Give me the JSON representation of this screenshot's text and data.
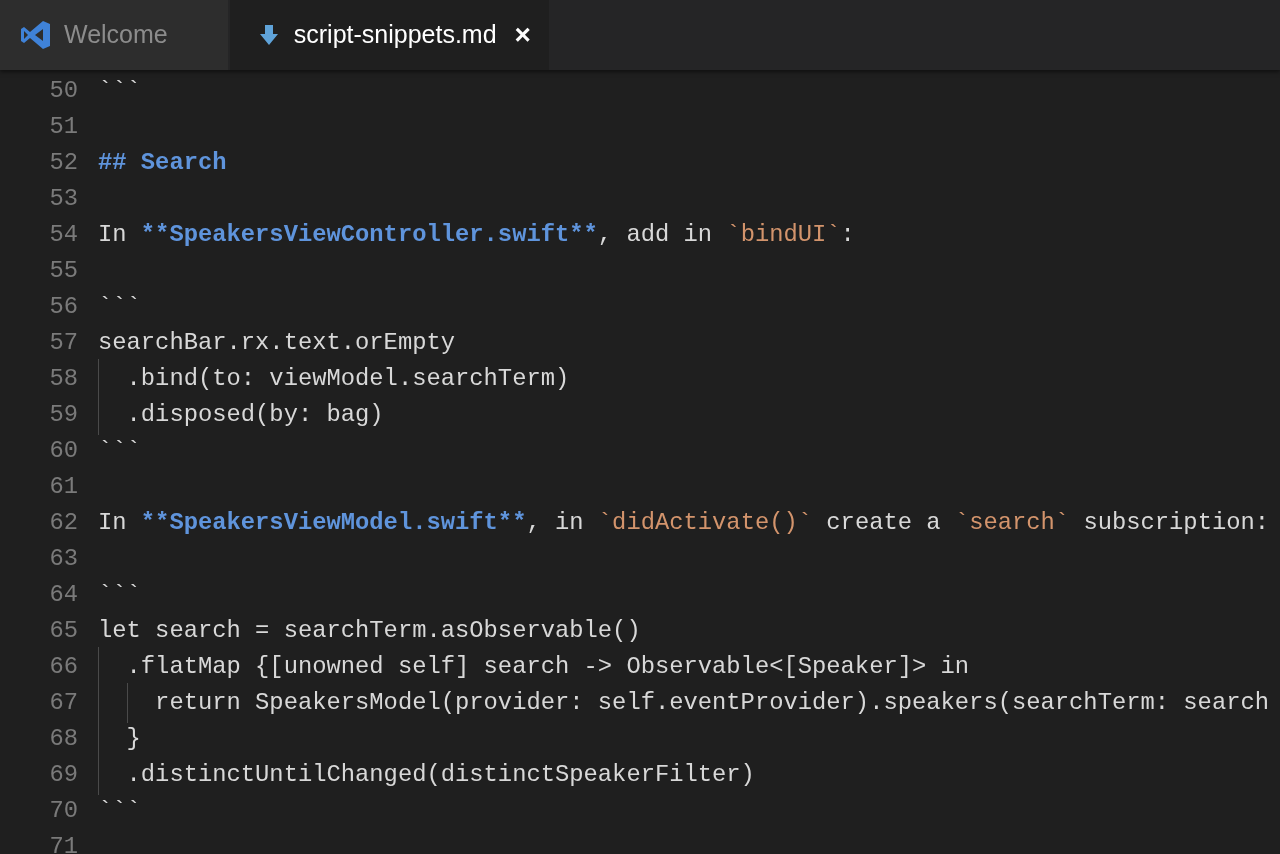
{
  "tabs": [
    {
      "label": "Welcome",
      "selected": false
    },
    {
      "label": "script-snippets.md",
      "selected": true,
      "close": "×"
    }
  ],
  "editor": {
    "lines": [
      {
        "number": "50",
        "tokens": [
          {
            "kind": "text",
            "text": "```"
          }
        ]
      },
      {
        "number": "51"
      },
      {
        "number": "52",
        "tokens": [
          {
            "kind": "heading",
            "text": "## Search"
          }
        ]
      },
      {
        "number": "53"
      },
      {
        "number": "54",
        "tokens": [
          {
            "kind": "text",
            "text": "In "
          },
          {
            "kind": "bold",
            "text": "**SpeakersViewController.swift**"
          },
          {
            "kind": "text",
            "text": ", add in "
          },
          {
            "kind": "code",
            "text": "`bindUI`"
          },
          {
            "kind": "text",
            "text": ":"
          }
        ]
      },
      {
        "number": "55"
      },
      {
        "number": "56",
        "tokens": [
          {
            "kind": "text",
            "text": "```"
          }
        ]
      },
      {
        "number": "57",
        "tokens": [
          {
            "kind": "text",
            "text": "searchBar.rx.text.orEmpty"
          }
        ]
      },
      {
        "number": "58",
        "tokens": [
          {
            "kind": "text",
            "text": "  .bind(to: viewModel.searchTerm)"
          }
        ]
      },
      {
        "number": "59",
        "tokens": [
          {
            "kind": "text",
            "text": "  .disposed(by: bag)"
          }
        ]
      },
      {
        "number": "60",
        "tokens": [
          {
            "kind": "text",
            "text": "```"
          }
        ]
      },
      {
        "number": "61"
      },
      {
        "number": "62",
        "tokens": [
          {
            "kind": "text",
            "text": "In "
          },
          {
            "kind": "bold",
            "text": "**SpeakersViewModel.swift**"
          },
          {
            "kind": "text",
            "text": ", in "
          },
          {
            "kind": "code",
            "text": "`didActivate()`"
          },
          {
            "kind": "text",
            "text": " create a "
          },
          {
            "kind": "code",
            "text": "`search`"
          },
          {
            "kind": "text",
            "text": " subscription:"
          }
        ]
      },
      {
        "number": "63"
      },
      {
        "number": "64",
        "tokens": [
          {
            "kind": "text",
            "text": "```"
          }
        ]
      },
      {
        "number": "65",
        "tokens": [
          {
            "kind": "text",
            "text": "let search = searchTerm.asObservable()"
          }
        ]
      },
      {
        "number": "66",
        "tokens": [
          {
            "kind": "text",
            "text": "  .flatMap {[unowned self] search -> Observable<[Speaker]> in"
          }
        ]
      },
      {
        "number": "67",
        "tokens": [
          {
            "kind": "text",
            "text": "    return SpeakersModel(provider: self.eventProvider).speakers(searchTerm: search"
          }
        ]
      },
      {
        "number": "68",
        "tokens": [
          {
            "kind": "text",
            "text": "  }"
          }
        ]
      },
      {
        "number": "69",
        "tokens": [
          {
            "kind": "text",
            "text": "  .distinctUntilChanged(distinctSpeakerFilter)"
          }
        ]
      },
      {
        "number": "70",
        "tokens": [
          {
            "kind": "text",
            "text": "```"
          }
        ]
      },
      {
        "number": "71"
      }
    ]
  }
}
